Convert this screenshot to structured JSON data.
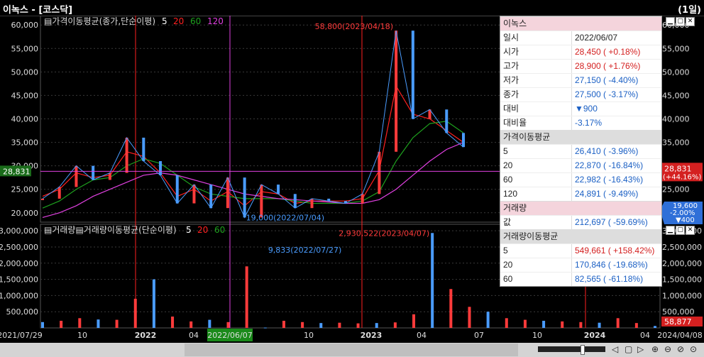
{
  "window": {
    "title": "이녹스 - [코스닥]",
    "period": "(1일)"
  },
  "colors": {
    "up": "#ff3b3b",
    "down": "#4a9cff",
    "ma5": "#ffffff",
    "ma20": "#ff2020",
    "ma60": "#1ea01e",
    "ma120": "#e040e0",
    "grid": "#3a3a3a",
    "current": "#ff3b3b"
  },
  "price_panel": {
    "legend_label": "가격이동평균(종가,단순이평)",
    "legend_periods": [
      "5",
      "20",
      "60",
      "120"
    ],
    "current_price_left": "28,831",
    "current_price_right": "28,831",
    "current_change_right": "(+44.16%)",
    "blue_badge_price": "19,600",
    "blue_badge_pct": "-2.00%",
    "blue_badge_change": "▼400"
  },
  "volume_panel": {
    "legend_label": "거래량",
    "legend_label2": "거래량이동평균(단순이평)",
    "legend_periods": [
      "5",
      "20",
      "60"
    ],
    "current_volume_badge": "58,877"
  },
  "x_axis": {
    "labels": [
      "2021/07/29",
      "10",
      "2022",
      "04",
      "2022/06/07",
      "10",
      "2023",
      "04",
      "07",
      "10",
      "2024",
      "04",
      "2024/04/08"
    ]
  },
  "chart_data": [
    {
      "type": "line",
      "title": "가격이동평균(종가,단순이평)",
      "x": [
        "2021/07/29",
        "2021/08",
        "2021/09",
        "2021/10",
        "2021/11",
        "2021/12",
        "2022/01",
        "2022/02",
        "2022/03",
        "2022/04",
        "2022/05",
        "2022/06/07",
        "2022/07/04",
        "2022/08",
        "2022/09",
        "2022/10",
        "2022/11",
        "2022/12",
        "2023/01",
        "2023/02",
        "2023/03",
        "2023/04/18",
        "2023/05",
        "2023/06",
        "2023/07",
        "2023/08"
      ],
      "series": [
        {
          "name": "5",
          "values": [
            23000,
            25500,
            30000,
            27000,
            28500,
            36000,
            31000,
            28000,
            22000,
            26000,
            21000,
            27500,
            19000,
            26000,
            24000,
            21000,
            23000,
            22500,
            22000,
            24000,
            33000,
            58800,
            40000,
            42000,
            37000,
            34000
          ]
        },
        {
          "name": "20",
          "values": [
            23500,
            25000,
            28500,
            27500,
            28000,
            33000,
            32000,
            28500,
            23500,
            25000,
            22500,
            24500,
            21500,
            24500,
            24000,
            22000,
            22500,
            22500,
            22500,
            23000,
            29000,
            47000,
            41000,
            40000,
            37500,
            35000
          ]
        },
        {
          "name": "60",
          "values": [
            21000,
            22500,
            25000,
            27000,
            27500,
            30000,
            31500,
            30500,
            28000,
            25500,
            24000,
            23500,
            23000,
            23000,
            23000,
            22500,
            22000,
            22000,
            22000,
            22500,
            24500,
            31000,
            36000,
            39000,
            39500,
            37000
          ]
        },
        {
          "name": "120",
          "values": [
            19000,
            20000,
            21500,
            23500,
            25000,
            26500,
            28000,
            28500,
            28000,
            27000,
            26000,
            25000,
            24000,
            23500,
            23000,
            22800,
            22500,
            22300,
            22000,
            22000,
            22800,
            25000,
            28000,
            31000,
            33500,
            35000
          ]
        }
      ],
      "ylim": [
        18000,
        62000
      ],
      "yticks": [
        20000,
        25000,
        30000,
        35000,
        40000,
        45000,
        50000,
        55000,
        60000
      ],
      "ytick_labels": [
        "20,000",
        "25,000",
        "30,000",
        "35,000",
        "40,000",
        "45,000",
        "50,000",
        "55,000",
        "60,000"
      ],
      "annotations": [
        {
          "text": "58,800(2023/04/18)",
          "x": "2023/04/18",
          "y": 58800
        },
        {
          "text": "19,000(2022/07/04)",
          "x": "2022/07/04",
          "y": 19000
        }
      ],
      "current_price": 28831
    },
    {
      "type": "bar",
      "title": "거래량이동평균(단순이평)",
      "categories": [
        "2021/07/29",
        "2021/08",
        "2021/09",
        "2021/10",
        "2021/11",
        "2021/12",
        "2022/01",
        "2022/02",
        "2022/03",
        "2022/04",
        "2022/05",
        "2022/06/07",
        "2022/07/27",
        "2022/08",
        "2022/09",
        "2022/10",
        "2022/11",
        "2022/12",
        "2023/01",
        "2023/02",
        "2023/03",
        "2023/04/07",
        "2023/05",
        "2023/06",
        "2023/07",
        "2023/08",
        "2023/09",
        "2023/10",
        "2023/11",
        "2023/12",
        "2024/01",
        "2024/02",
        "2024/03",
        "2024/04/08"
      ],
      "values": [
        180000,
        220000,
        300000,
        260000,
        250000,
        900000,
        1500000,
        350000,
        200000,
        250000,
        180000,
        1900000,
        9833,
        220000,
        180000,
        150000,
        160000,
        140000,
        150000,
        170000,
        420000,
        2930522,
        1200000,
        650000,
        500000,
        300000,
        250000,
        220000,
        200000,
        180000,
        160000,
        300000,
        150000,
        58877
      ],
      "ylim": [
        0,
        3200000
      ],
      "yticks": [
        500000,
        1000000,
        1500000,
        2000000,
        2500000,
        3000000
      ],
      "ytick_labels": [
        "500,000",
        "1,000,000",
        "1,500,000",
        "2,000,000",
        "2,500,000",
        "3,000,000"
      ],
      "annotations": [
        {
          "text": "2,930,522(2023/04/07)",
          "x": "2023/04/07",
          "y": 2930522
        },
        {
          "text": "9,833(2022/07/27)",
          "x": "2022/07/27",
          "y": 9833
        }
      ]
    }
  ],
  "info_box": {
    "stock_name": "이녹스",
    "rows": [
      {
        "k": "일시",
        "v": "2022/06/07",
        "tone": "dark"
      },
      {
        "k": "시가",
        "v": "28,450 ( +0.18%)",
        "tone": "up"
      },
      {
        "k": "고가",
        "v": "28,900 ( +1.76%)",
        "tone": "up"
      },
      {
        "k": "저가",
        "v": "27,150 ( -4.40%)",
        "tone": "down"
      },
      {
        "k": "종가",
        "v": "27,500 ( -3.17%)",
        "tone": "down"
      },
      {
        "k": "대비",
        "v": "▼900",
        "tone": "down"
      },
      {
        "k": "대비율",
        "v": "-3.17%",
        "tone": "down"
      }
    ],
    "ma_title": "가격이동평균",
    "ma_rows": [
      {
        "k": "5",
        "v": "26,410 ( -3.96%)",
        "tone": "down"
      },
      {
        "k": "20",
        "v": "22,870 ( -16.84%)",
        "tone": "down"
      },
      {
        "k": "60",
        "v": "22,982 ( -16.43%)",
        "tone": "down"
      },
      {
        "k": "120",
        "v": "24,891 ( -9.49%)",
        "tone": "down"
      }
    ],
    "vol_title": "거래량",
    "vol_rows": [
      {
        "k": "값",
        "v": "212,697 ( -59.69%)",
        "tone": "down"
      }
    ],
    "vma_title": "거래량이동평균",
    "vma_rows": [
      {
        "k": "5",
        "v": "549,661 ( +158.42%)",
        "tone": "up"
      },
      {
        "k": "20",
        "v": "170,846 ( -19.68%)",
        "tone": "down"
      },
      {
        "k": "60",
        "v": "82,565 ( -61.18%)",
        "tone": "down"
      }
    ]
  }
}
